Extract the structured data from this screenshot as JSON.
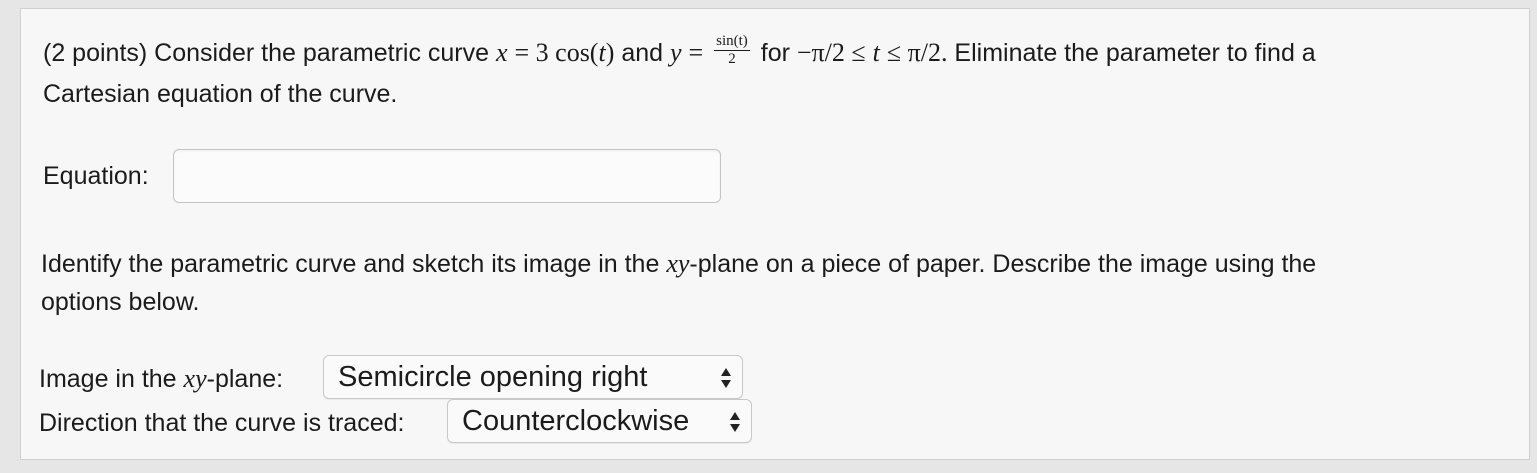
{
  "question": {
    "prefix": "(2 points) Consider the parametric curve",
    "x_var": "x",
    "eq1": "= 3 cos(",
    "t1": "t",
    "close1": ")",
    "and_word": "and",
    "y_var": "y",
    "eq2": "=",
    "frac_num": "sin(t)",
    "frac_den": "2",
    "for_word": "for",
    "range_left": "−π/2 ≤",
    "t2": "t",
    "range_right": "≤ π/2.",
    "suffix": "Eliminate the parameter to find a",
    "line2": "Cartesian equation of the curve."
  },
  "equation": {
    "label": "Equation:",
    "value": ""
  },
  "identify": {
    "line1_a": "Identify the parametric curve and sketch its image in the",
    "line1_xy": "xy",
    "line1_b": "-plane on a piece of paper. Describe the image using the",
    "line2": "options below."
  },
  "image_select": {
    "label_a": "Image in the",
    "label_xy": "xy",
    "label_b": "-plane:",
    "selected": "Semicircle opening right"
  },
  "direction_select": {
    "label": "Direction that the curve is traced:",
    "selected": "Counterclockwise"
  }
}
